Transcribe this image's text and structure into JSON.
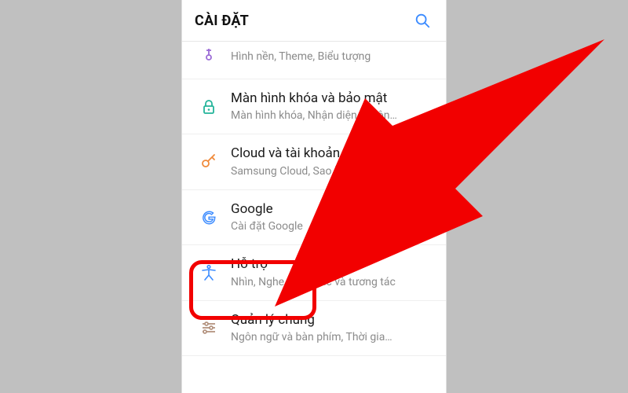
{
  "header": {
    "title": "CÀI ĐẶT",
    "search_name": "search-icon"
  },
  "colors": {
    "accent_blue": "#3b8bff",
    "purple": "#9b6bd6",
    "teal": "#23b49a",
    "orange": "#f08a3a",
    "brown": "#b49480",
    "red_annotation": "#f20000"
  },
  "items": [
    {
      "key": "wallpaper",
      "label": "",
      "sub": "Hình nền, Theme, Biểu tượng",
      "icon": "brush-icon"
    },
    {
      "key": "lockscreen",
      "label": "Màn hình khóa và bảo mật",
      "sub": "Màn hình khóa, Nhận diện khuôn…",
      "icon": "lock-icon"
    },
    {
      "key": "cloud",
      "label": "Cloud và tài khoản",
      "sub": "Samsung Cloud, Sao lưu và kh…",
      "icon": "key-icon"
    },
    {
      "key": "google",
      "label": "Google",
      "sub": "Cài đặt Google",
      "icon": "google-icon"
    },
    {
      "key": "accessibility",
      "label": "Hỗ trợ",
      "sub": "Nhìn, Nghe, Thao tác và tương tác",
      "icon": "accessibility-icon"
    },
    {
      "key": "general",
      "label": "Quản lý chung",
      "sub": "Ngôn ngữ và bàn phím, Thời gia…",
      "icon": "sliders-icon"
    }
  ]
}
